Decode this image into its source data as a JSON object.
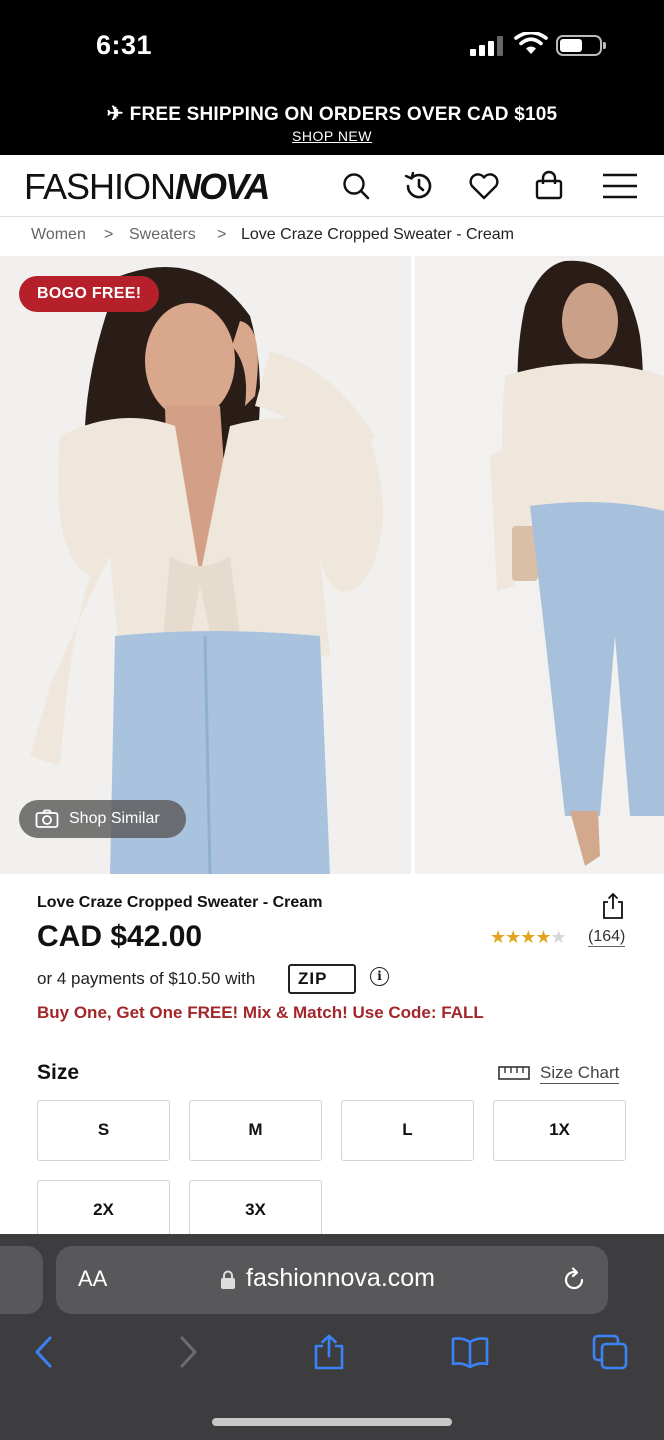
{
  "status_bar": {
    "time": "6:31"
  },
  "promo_banner": {
    "text": "FREE SHIPPING ON ORDERS OVER CAD $105",
    "link": "SHOP NEW"
  },
  "header": {
    "logo_light": "FASHION",
    "logo_bold": "NOVA"
  },
  "breadcrumb": {
    "items": [
      "Women",
      "Sweaters",
      "Love Craze Cropped Sweater - Cream"
    ],
    "separator": ">"
  },
  "gallery": {
    "badge": "BOGO FREE!",
    "shop_similar": "Shop Similar"
  },
  "product": {
    "name": "Love Craze Cropped Sweater - Cream",
    "price": "CAD $42.00",
    "rating": {
      "stars": 4,
      "max": 5,
      "reviews": "(164)"
    },
    "installments": "or 4 payments of $10.50 with",
    "zip_logo": "ZIP",
    "info_icon": "i",
    "promo": "Buy One, Get One FREE! Mix & Match! Use Code: FALL"
  },
  "size": {
    "label": "Size",
    "chart_link": "Size Chart",
    "options": [
      "S",
      "M",
      "L",
      "1X",
      "2X",
      "3X"
    ]
  },
  "browser": {
    "aa": "AA",
    "url": "fashionnova.com"
  },
  "colors": {
    "badge_red": "#b5202a",
    "promo_red": "#a3262b",
    "star_gold": "#e2a521",
    "ios_blue": "#3b82f6"
  }
}
